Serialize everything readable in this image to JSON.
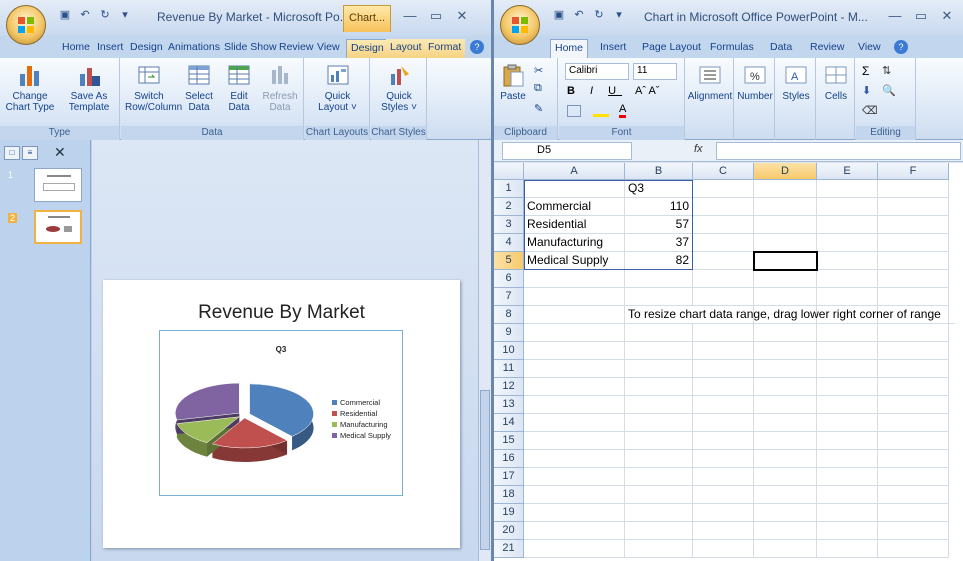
{
  "ppt": {
    "title": "Revenue By Market - Microsoft Po...",
    "context_tab": "Chart...",
    "tabs": [
      "Home",
      "Insert",
      "Design",
      "Animations",
      "Slide Show",
      "Review",
      "View",
      "Design",
      "Layout",
      "Format"
    ],
    "active_tab_index": 7,
    "ribbon": {
      "type_group": "Type",
      "data_group": "Data",
      "layouts_group": "Chart Layouts",
      "styles_group": "Chart Styles",
      "change_chart_type": [
        "Change",
        "Chart Type"
      ],
      "save_as_template": [
        "Save As",
        "Template"
      ],
      "switch_row_column": [
        "Switch",
        "Row/Column"
      ],
      "select_data": [
        "Select",
        "Data"
      ],
      "edit_data": [
        "Edit",
        "Data"
      ],
      "refresh_data": [
        "Refresh",
        "Data"
      ],
      "quick_layout": [
        "Quick",
        "Layout ˅"
      ],
      "quick_styles": [
        "Quick",
        "Styles ˅"
      ]
    },
    "slides": [
      {
        "num": "1"
      },
      {
        "num": "2"
      }
    ],
    "slide": {
      "title": "Revenue By Market",
      "chart_title": "Q3"
    }
  },
  "chart_data": {
    "type": "pie",
    "title": "Q3",
    "categories": [
      "Commercial",
      "Residential",
      "Manufacturing",
      "Medical Supply"
    ],
    "values": [
      110,
      57,
      37,
      82
    ],
    "colors": [
      "#4f81bd",
      "#c0504d",
      "#9bbb59",
      "#8064a2"
    ],
    "legend": "right",
    "style": "3d-exploded"
  },
  "xl": {
    "title": "Chart in Microsoft Office PowerPoint - M...",
    "tabs": [
      "Home",
      "Insert",
      "Page Layout",
      "Formulas",
      "Data",
      "Review",
      "View"
    ],
    "font_name": "Calibri",
    "font_size": "11",
    "groups": {
      "clipboard": "Clipboard",
      "font": "Font",
      "editing": "Editing"
    },
    "buttons": {
      "paste": "Paste",
      "alignment": "Alignment",
      "number": "Number",
      "styles": "Styles",
      "cells": "Cells"
    },
    "name_box": "D5",
    "fx": "fx",
    "columns": [
      "A",
      "B",
      "C",
      "D",
      "E",
      "F"
    ],
    "rows": [
      "1",
      "2",
      "3",
      "4",
      "5",
      "6",
      "7",
      "8",
      "9",
      "10",
      "11",
      "12",
      "13",
      "14",
      "15",
      "16",
      "17",
      "18",
      "19",
      "20",
      "21"
    ],
    "header_b1": "Q3",
    "data": [
      {
        "label": "Commercial",
        "value": "110"
      },
      {
        "label": "Residential",
        "value": "57"
      },
      {
        "label": "Manufacturing",
        "value": "37"
      },
      {
        "label": "Medical Supply",
        "value": "82"
      }
    ],
    "note": "To resize chart data range, drag lower right corner of range"
  }
}
